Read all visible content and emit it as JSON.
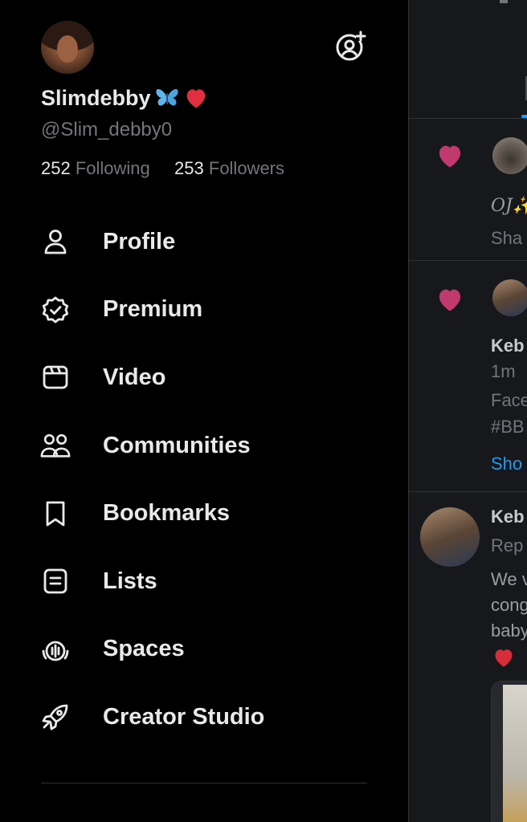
{
  "profile": {
    "display_name": "Slimdebby",
    "name_emojis": [
      "butterfly",
      "red-heart"
    ],
    "handle": "@Slim_debby0",
    "following_count": "252",
    "following_label": "Following",
    "followers_count": "253",
    "followers_label": "Followers"
  },
  "menu": {
    "items": [
      {
        "label": "Profile",
        "icon": "person-icon"
      },
      {
        "label": "Premium",
        "icon": "verified-badge-icon"
      },
      {
        "label": "Video",
        "icon": "video-icon"
      },
      {
        "label": "Communities",
        "icon": "communities-icon"
      },
      {
        "label": "Bookmarks",
        "icon": "bookmark-icon"
      },
      {
        "label": "Lists",
        "icon": "list-icon"
      },
      {
        "label": "Spaces",
        "icon": "spaces-icon"
      },
      {
        "label": "Creator Studio",
        "icon": "rocket-icon"
      }
    ]
  },
  "feed": {
    "post1_line1": "OJ✨",
    "post1_line2": "Sha",
    "post2_author": "Keb",
    "post2_time": "1m",
    "post2_line1": "Face",
    "post2_line2": "#BB",
    "post2_show": "Sho",
    "post3_author": "Keb",
    "post3_sub": "Rep",
    "post3_line1": "We v",
    "post3_line2": "cong",
    "post3_line3": "baby"
  },
  "colors": {
    "background": "#000000",
    "feed_background": "#16181c",
    "text_primary": "#e7e9ea",
    "text_secondary": "#71767b",
    "heart": "#c0396f",
    "accent": "#1d9bf0"
  }
}
